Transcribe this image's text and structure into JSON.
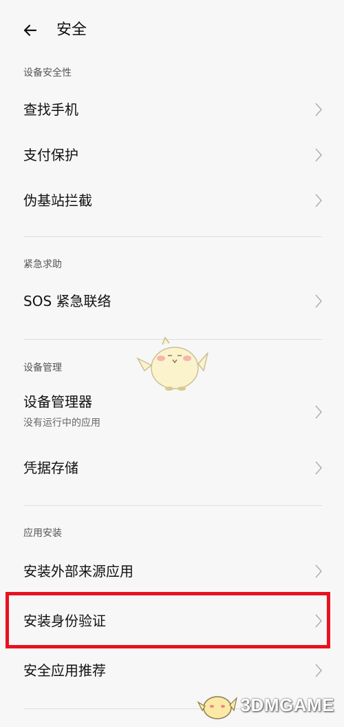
{
  "header": {
    "title": "安全"
  },
  "sections": {
    "device_security": {
      "label": "设备安全性",
      "items": [
        "查找手机",
        "支付保护",
        "伪基站拦截"
      ]
    },
    "emergency": {
      "label": "紧急求助",
      "items": [
        "SOS 紧急联络"
      ]
    },
    "device_management": {
      "label": "设备管理",
      "items": [
        "设备管理器",
        "凭据存储"
      ],
      "device_manager_sub": "没有运行中的应用"
    },
    "app_install": {
      "label": "应用安装",
      "items": [
        "安装外部来源应用",
        "安装身份验证",
        "安全应用推荐"
      ]
    }
  },
  "watermark": {
    "text": "3DMGAME"
  },
  "colors": {
    "highlight": "#e8121f",
    "background": "#f7f7f7",
    "divider": "#dedede"
  }
}
